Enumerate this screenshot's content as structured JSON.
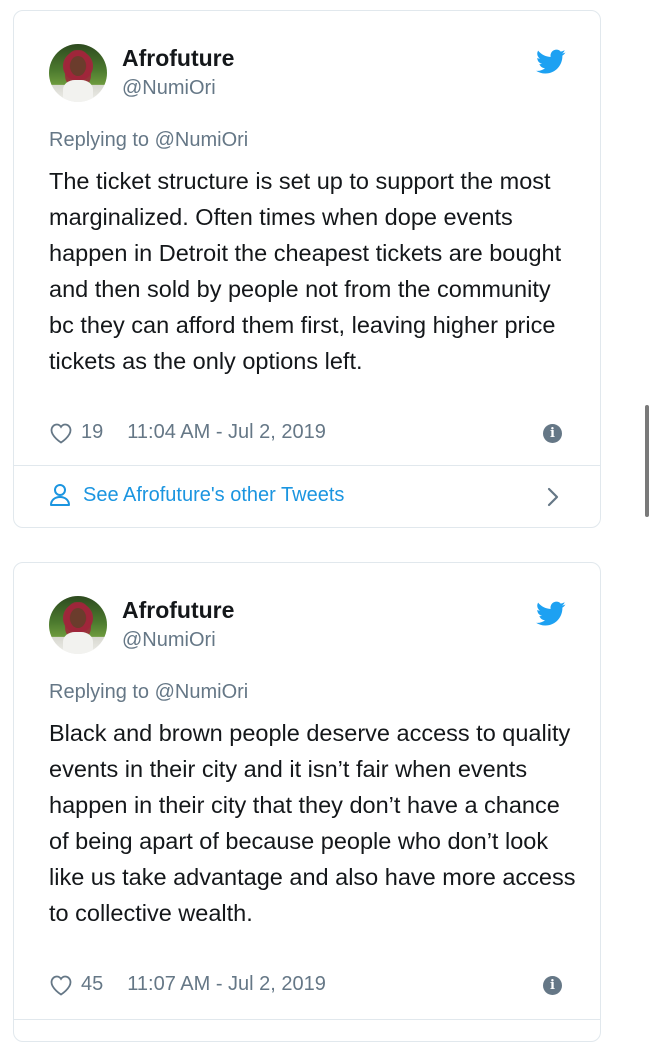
{
  "tweets": [
    {
      "display_name": "Afrofuture",
      "handle": "@NumiOri",
      "replying_to": "Replying to @NumiOri",
      "text": "The ticket structure is set up to support the most marginalized. Often times when dope events happen in Detroit the cheapest tickets are bought and then sold by people not from the community bc they can afford them first, leaving higher price tickets as the only options left.",
      "likes": "19",
      "timestamp": "11:04 AM - Jul 2, 2019",
      "other_tweets_link": "See Afrofuture's other Tweets"
    },
    {
      "display_name": "Afrofuture",
      "handle": "@NumiOri",
      "replying_to": "Replying to @NumiOri",
      "text": "Black and brown people deserve access to quality events in their city and it isn’t fair when events happen in their city that they don’t have a chance of being apart of because people who don’t look like us take advantage and also have more access to collective wealth.",
      "likes": "45",
      "timestamp": "11:07 AM - Jul 2, 2019"
    }
  ],
  "icons": {
    "brand": "twitter-bird-icon",
    "like": "heart-icon",
    "info": "info-icon",
    "profile": "person-icon",
    "next": "chevron-right-icon"
  },
  "colors": {
    "twitter_blue": "#1da1f2",
    "link_blue": "#1b95e0",
    "secondary_text": "#657786",
    "border": "#e1e8ed"
  }
}
